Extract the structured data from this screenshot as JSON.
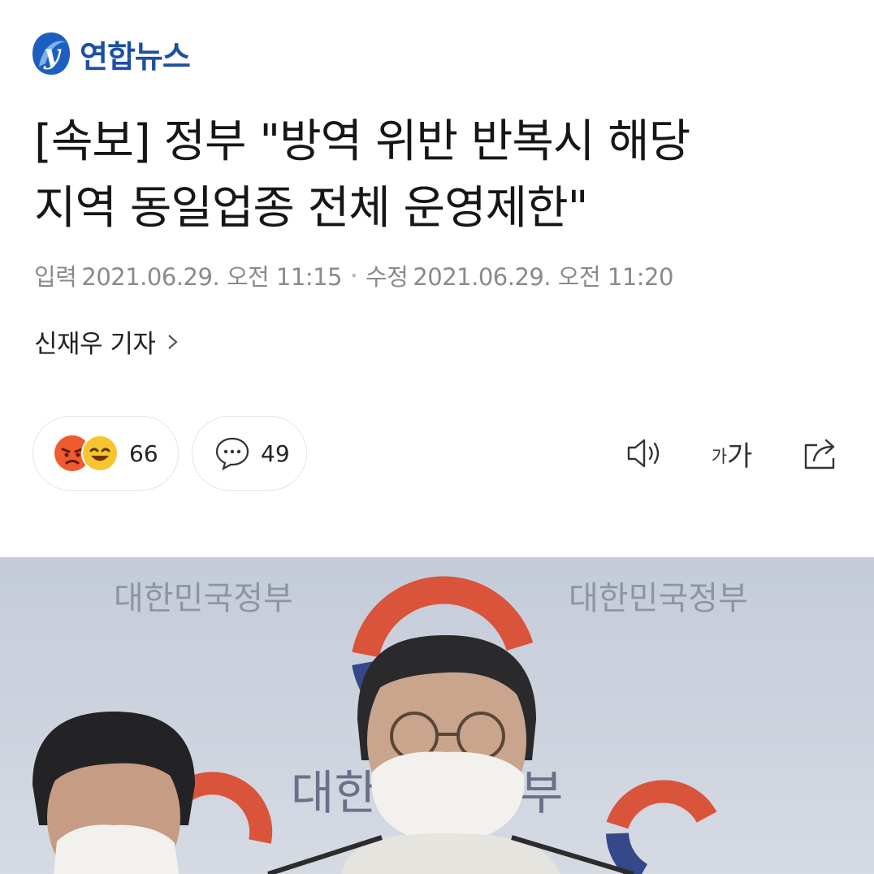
{
  "brand": {
    "logo_letter": "y",
    "name": "연합뉴스",
    "color": "#1d4fa3"
  },
  "article": {
    "headline_line1": "[속보] 정부 \"방역 위반 반복시 해당",
    "headline_line2": "지역 동일업종 전체 운영제한\"",
    "published_label": "입력",
    "published_value": "2021.06.29. 오전 11:15",
    "separator": "•",
    "modified_label": "수정",
    "modified_value": "2021.06.29. 오전 11:20",
    "reporter": "신재우 기자"
  },
  "actions": {
    "reaction_count": "66",
    "comment_count": "49",
    "font_small": "가",
    "font_big": "가",
    "icons": [
      "angry-emoji-icon",
      "laughing-emoji-icon",
      "comment-bubble-icon",
      "speaker-icon",
      "font-size-icon",
      "share-icon"
    ]
  },
  "photo": {
    "backdrop_text": "대한민국정부",
    "center_text_left": "대한",
    "center_text_right": "부"
  }
}
